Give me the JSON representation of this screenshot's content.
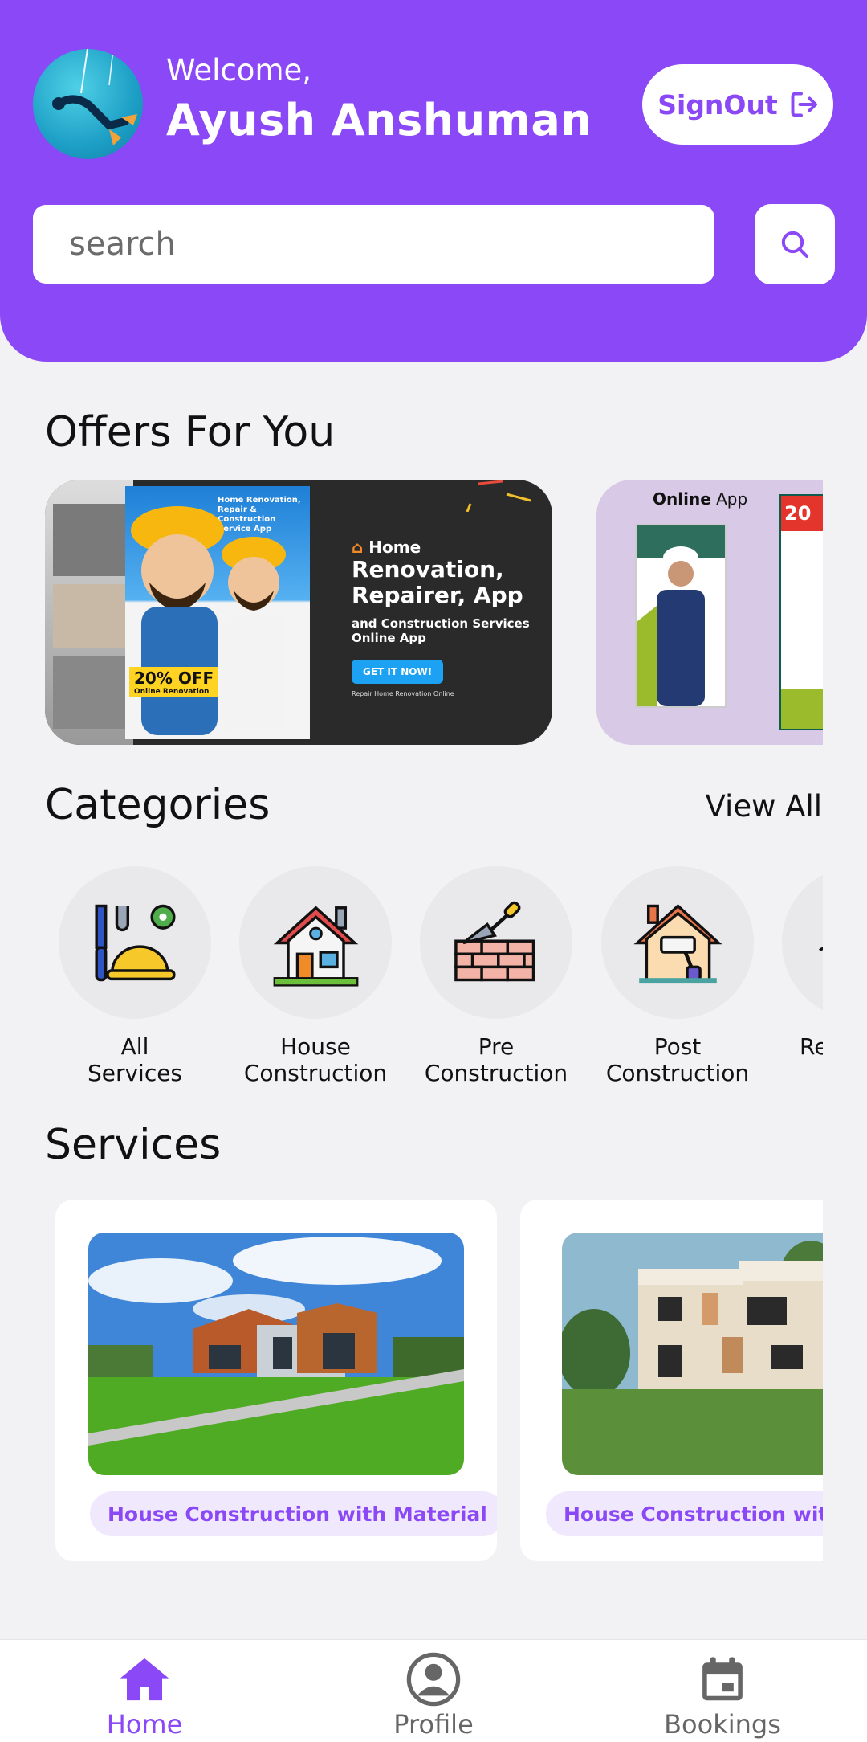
{
  "header": {
    "welcome": "Welcome,",
    "user_name": "Ayush Anshuman",
    "signout_label": "SignOut",
    "search_placeholder": "search",
    "avatar_icon": "diver-avatar"
  },
  "offers": {
    "title": "Offers For You",
    "banner1": {
      "top_text": "Home Renovation, Repair & Construction Service App",
      "discount": "20% OFF",
      "discount_sub": "Online Renovation",
      "home": "Home",
      "headline1": "Renovation,",
      "headline2": "Repairer, App",
      "sub1": "and Construction Services",
      "sub2": "Online App",
      "cta": "GET IT NOW!",
      "foot": "Repair Home Renovation Online"
    },
    "banner2": {
      "title_bold": "Online",
      "title_rest": " App",
      "right_num": "20"
    }
  },
  "categories": {
    "title": "Categories",
    "view_all": "View All",
    "items": [
      {
        "line1": "All",
        "line2": "Services",
        "icon": "tools-helmet-icon"
      },
      {
        "line1": "House",
        "line2": "Construction",
        "icon": "house-icon"
      },
      {
        "line1": "Pre",
        "line2": "Construction",
        "icon": "brick-trowel-icon"
      },
      {
        "line1": "Post",
        "line2": "Construction",
        "icon": "house-paint-roller-icon"
      },
      {
        "line1": "Re",
        "line2": "",
        "icon": "partial-icon"
      }
    ]
  },
  "services": {
    "title": "Services",
    "items": [
      {
        "label": "House Construction with Material"
      },
      {
        "label": "House Construction witho"
      }
    ]
  },
  "nav": {
    "home": "Home",
    "profile": "Profile",
    "bookings": "Bookings",
    "active_color": "#8a48f6",
    "inactive_color": "#666666"
  },
  "colors": {
    "accent": "#8a48f6",
    "background": "#f2f1f3"
  }
}
